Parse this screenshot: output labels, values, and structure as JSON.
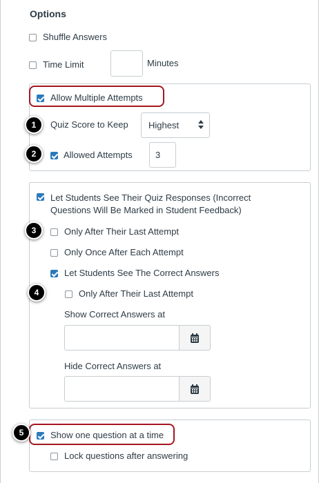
{
  "section_title": "Options",
  "shuffle": {
    "label": "Shuffle Answers",
    "checked": false
  },
  "time_limit": {
    "label": "Time Limit",
    "value": "",
    "unit": "Minutes",
    "checked": false
  },
  "multiple_attempts": {
    "label": "Allow Multiple Attempts",
    "checked": true,
    "score_to_keep_label": "Quiz Score to Keep",
    "score_to_keep_value": "Highest",
    "allowed_attempts_label": "Allowed Attempts",
    "allowed_attempts_checked": true,
    "allowed_attempts_value": "3"
  },
  "responses": {
    "label_line1": "Let Students See Their Quiz Responses (Incorrect",
    "label_line2": "Questions Will Be Marked in Student Feedback)",
    "checked": true,
    "only_after_last": "Only After Their Last Attempt",
    "only_once": "Only Once After Each Attempt",
    "see_correct": "Let Students See The Correct Answers",
    "correct_only_after_last": "Only After Their Last Attempt",
    "show_correct_at": "Show Correct Answers at",
    "hide_correct_at": "Hide Correct Answers at"
  },
  "one_question": {
    "label": "Show one question at a time",
    "checked": true,
    "lock_label": "Lock questions after answering"
  },
  "markers": [
    "1",
    "2",
    "3",
    "4",
    "5"
  ],
  "colors": {
    "accent": "#2b7abc",
    "highlight": "#a4151f",
    "border": "#c7cdd1",
    "text": "#2d3b45"
  },
  "icons": {
    "calendar": "calendar-icon",
    "select_arrows": "sort-arrows-icon"
  }
}
